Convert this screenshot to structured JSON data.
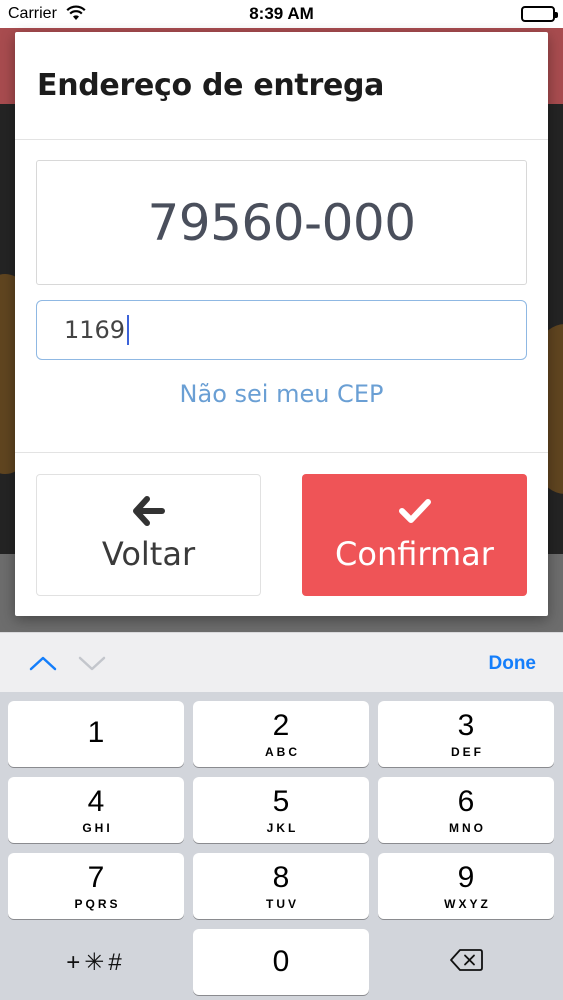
{
  "status_bar": {
    "carrier": "Carrier",
    "time": "8:39 AM"
  },
  "modal": {
    "title": "Endereço de entrega",
    "cep_value": "79560-000",
    "number_input_value": "1169",
    "cep_help_link": "Não sei meu CEP",
    "back_button_label": "Voltar",
    "confirm_button_label": "Confirmar",
    "colors": {
      "confirm": "#ef5457",
      "link": "#6a9fd4",
      "input_focus_border": "#8fb8e3"
    }
  },
  "keyboard": {
    "done_label": "Done",
    "keys": [
      {
        "digit": "1",
        "letters": ""
      },
      {
        "digit": "2",
        "letters": "ABC"
      },
      {
        "digit": "3",
        "letters": "DEF"
      },
      {
        "digit": "4",
        "letters": "GHI"
      },
      {
        "digit": "5",
        "letters": "JKL"
      },
      {
        "digit": "6",
        "letters": "MNO"
      },
      {
        "digit": "7",
        "letters": "PQRS"
      },
      {
        "digit": "8",
        "letters": "TUV"
      },
      {
        "digit": "9",
        "letters": "WXYZ"
      }
    ],
    "symbols_key": "+✳#",
    "zero_key": "0",
    "icons": {
      "prev_field": "chevron-up-icon",
      "next_field": "chevron-down-icon",
      "delete": "backspace-icon"
    },
    "colors": {
      "done": "#147efb"
    }
  }
}
